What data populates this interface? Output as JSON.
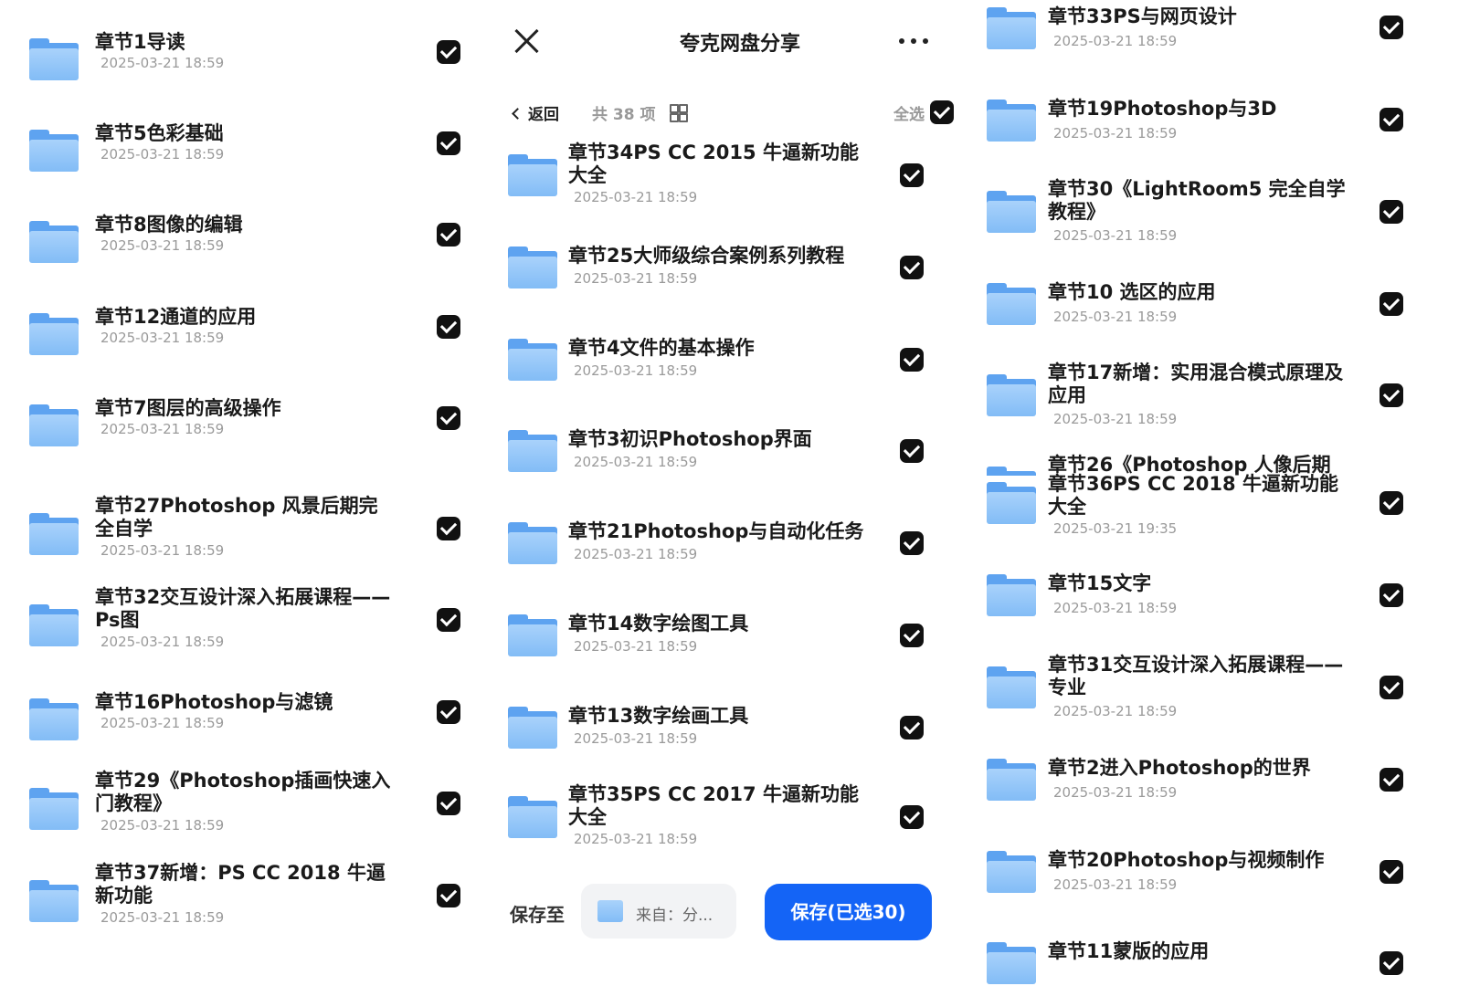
{
  "header": {
    "title": "夸克网盘分享",
    "back_label": "返回",
    "count_label": "共 38 项",
    "select_all_label": "全选"
  },
  "left": {
    "items": [
      {
        "title": "章节1导读",
        "date": "2025-03-21 18:59",
        "checked": true
      },
      {
        "title": "章节5色彩基础",
        "date": "2025-03-21 18:59",
        "checked": true
      },
      {
        "title": "章节8图像的编辑",
        "date": "2025-03-21 18:59",
        "checked": true
      },
      {
        "title": "章节12通道的应用",
        "date": "2025-03-21 18:59",
        "checked": true
      },
      {
        "title": "章节7图层的高级操作",
        "date": "2025-03-21 18:59",
        "checked": true
      },
      {
        "title": "章节27Photoshop 风景后期完全自学",
        "date": "2025-03-21 18:59",
        "checked": true
      },
      {
        "title": "章节32交互设计深入拓展课程——Ps图",
        "date": "2025-03-21 18:59",
        "checked": true
      },
      {
        "title": "章节16Photoshop与滤镜",
        "date": "2025-03-21 18:59",
        "checked": true
      },
      {
        "title": "章节29《Photoshop插画快速入门教程》",
        "date": "2025-03-21 18:59",
        "checked": true
      },
      {
        "title": "章节37新增：PS CC 2018 牛逼新功能",
        "date": "2025-03-21 18:59",
        "checked": true
      }
    ]
  },
  "middle": {
    "items": [
      {
        "title": "章节34PS CC 2015 牛逼新功能大全",
        "date": "2025-03-21 18:59",
        "checked": true
      },
      {
        "title": "章节25大师级综合案例系列教程",
        "date": "2025-03-21 18:59",
        "checked": true
      },
      {
        "title": "章节4文件的基本操作",
        "date": "2025-03-21 18:59",
        "checked": true
      },
      {
        "title": "章节3初识Photoshop界面",
        "date": "2025-03-21 18:59",
        "checked": true
      },
      {
        "title": "章节21Photoshop与自动化任务",
        "date": "2025-03-21 18:59",
        "checked": true
      },
      {
        "title": "章节14数字绘图工具",
        "date": "2025-03-21 18:59",
        "checked": true
      },
      {
        "title": "章节13数字绘画工具",
        "date": "2025-03-21 18:59",
        "checked": true
      },
      {
        "title": "章节35PS CC 2017 牛逼新功能大全",
        "date": "2025-03-21 18:59",
        "checked": true
      }
    ]
  },
  "right": {
    "items": [
      {
        "title": "章节33PS与网页设计",
        "date": "2025-03-21 18:59",
        "checked": true
      },
      {
        "title": "章节19Photoshop与3D",
        "date": "2025-03-21 18:59",
        "checked": true
      },
      {
        "title": "章节30《LightRoom5 完全自学教程》",
        "date": "2025-03-21 18:59",
        "checked": true
      },
      {
        "title": "章节10 选区的应用",
        "date": "2025-03-21 18:59",
        "checked": true
      },
      {
        "title": "章节17新增：实用混合模式原理及应用",
        "date": "2025-03-21 18:59",
        "checked": true
      },
      {
        "title": "章节26《Photoshop 人像后期完",
        "date": "",
        "checked": true
      },
      {
        "title": "章节36PS CC 2018 牛逼新功能大全",
        "date": "2025-03-21 19:35",
        "checked": true
      },
      {
        "title": "章节15文字",
        "date": "2025-03-21 18:59",
        "checked": true
      },
      {
        "title": "章节31交互设计深入拓展课程——专业",
        "date": "2025-03-21 18:59",
        "checked": true
      },
      {
        "title": "章节2进入Photoshop的世界",
        "date": "2025-03-21 18:59",
        "checked": true
      },
      {
        "title": "章节20Photoshop与视频制作",
        "date": "2025-03-21 18:59",
        "checked": true
      },
      {
        "title": "章节11蒙版的应用",
        "date": "",
        "checked": true
      }
    ]
  },
  "footer": {
    "save_to_label": "保存至",
    "source_label": "来自：分...",
    "save_button_label": "保存(已选30)"
  },
  "colors": {
    "accent": "#1464f6",
    "folder": "#82bcf6",
    "checkbox": "#111111"
  }
}
